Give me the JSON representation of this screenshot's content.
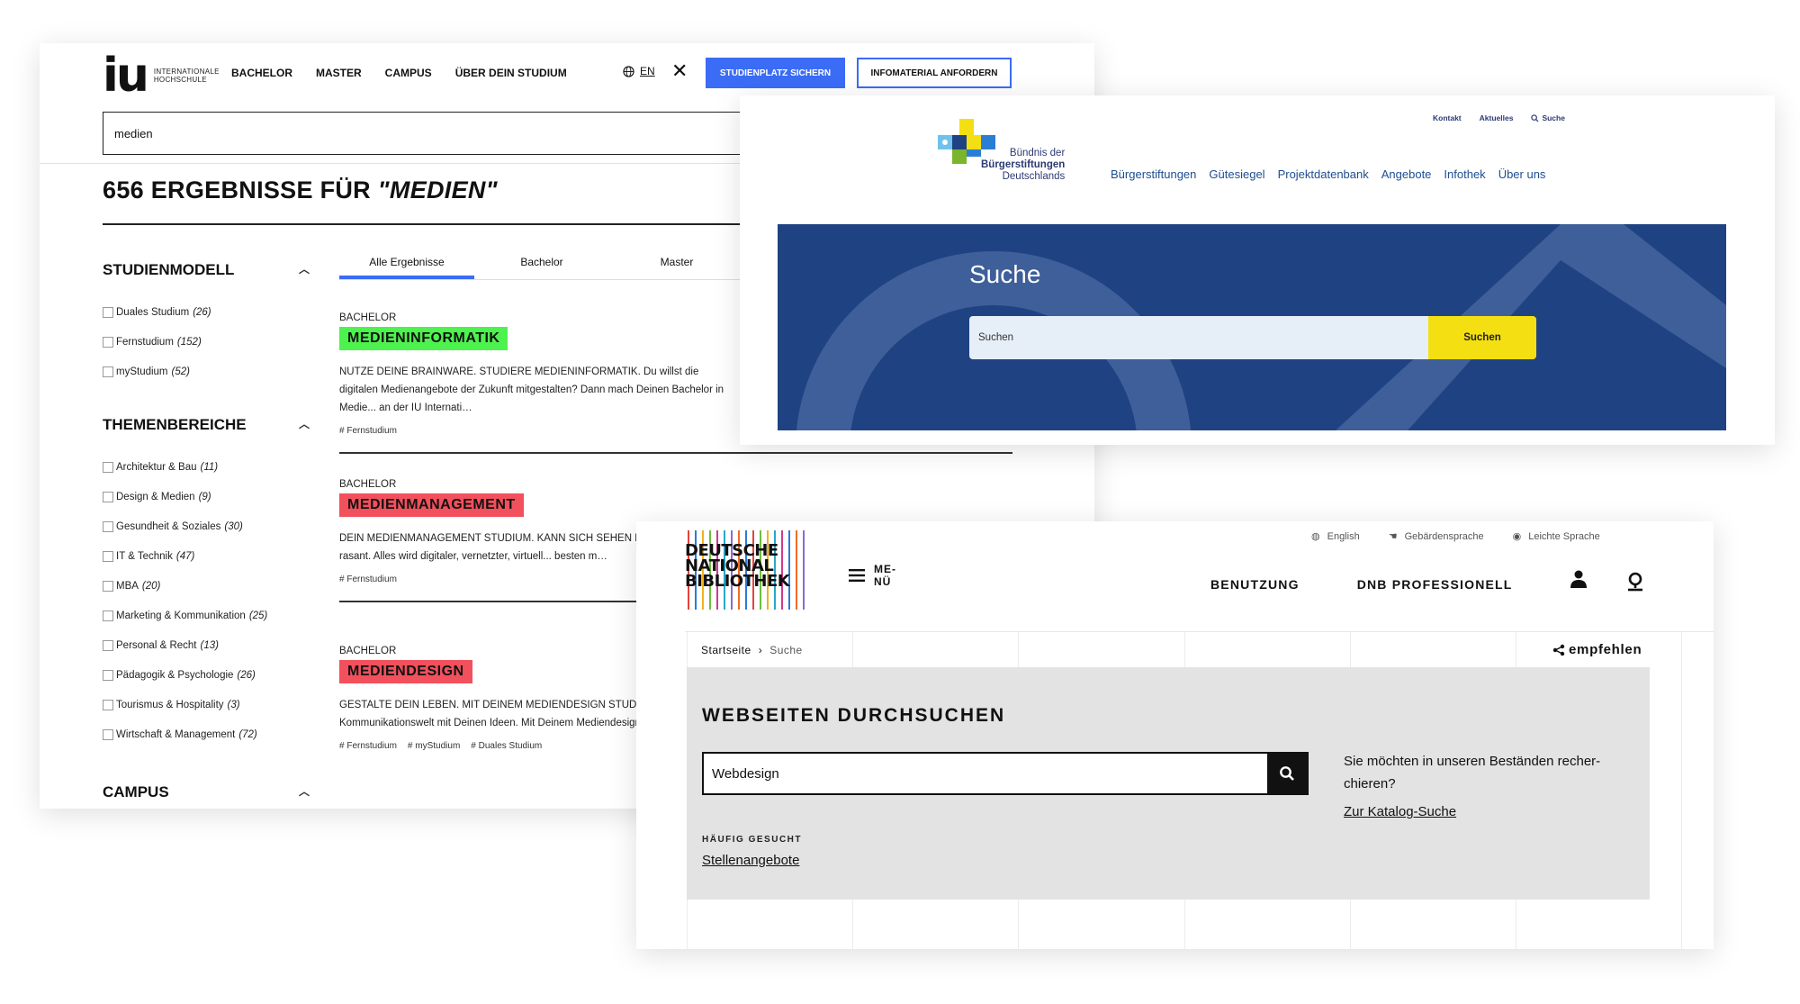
{
  "iu": {
    "logo_mark": "iu",
    "logo_sub": "INTERNATIONALE HOCHSCHULE",
    "nav": [
      "BACHELOR",
      "MASTER",
      "CAMPUS",
      "ÜBER DEIN STUDIUM"
    ],
    "lang": "EN",
    "cta_primary": "STUDIENPLATZ SICHERN",
    "cta_secondary": "INFOMATERIAL ANFORDERN",
    "search_value": "medien",
    "results_count": "656 ERGEBNISSE FÜR",
    "results_query": "\"MEDIEN\"",
    "filter_groups": [
      {
        "title": "STUDIENMODELL",
        "items": [
          {
            "label": "Duales Studium",
            "count": "(26)"
          },
          {
            "label": "Fernstudium",
            "count": "(152)"
          },
          {
            "label": "myStudium",
            "count": "(52)"
          }
        ]
      },
      {
        "title": "THEMENBEREICHE",
        "items": [
          {
            "label": "Architektur & Bau",
            "count": "(11)"
          },
          {
            "label": "Design & Medien",
            "count": "(9)"
          },
          {
            "label": "Gesundheit & Soziales",
            "count": "(30)"
          },
          {
            "label": "IT & Technik",
            "count": "(47)"
          },
          {
            "label": "MBA",
            "count": "(20)"
          },
          {
            "label": "Marketing & Kommunikation",
            "count": "(25)"
          },
          {
            "label": "Personal & Recht",
            "count": "(13)"
          },
          {
            "label": "Pädagogik & Psychologie",
            "count": "(26)"
          },
          {
            "label": "Tourismus & Hospitality",
            "count": "(3)"
          },
          {
            "label": "Wirtschaft & Management",
            "count": "(72)"
          }
        ]
      },
      {
        "title": "CAMPUS",
        "items": []
      }
    ],
    "tabs": [
      "Alle Ergebnisse",
      "Bachelor",
      "Master"
    ],
    "results": [
      {
        "category": "BACHELOR",
        "title": "MEDIENINFORMATIK",
        "color": "#4ef24e",
        "description": "NUTZE DEINE BRAINWARE. STUDIERE MEDIENINFORMATIK. Du willst die digitalen Medienangebote der Zukunft mitgestalten? Dann mach Deinen Bachelor in Medie... an der IU Internati…",
        "tags": [
          "# Fernstudium"
        ]
      },
      {
        "category": "BACHELOR",
        "title": "MEDIENMANAGEMENT",
        "color": "#f2505c",
        "description": "DEIN MEDIENMANAGEMENT STUDIUM. KANN SICH SEHEN LA... verändert sich rasant. Alles wird digitaler, vernetzter, virtuell... besten m…",
        "tags": [
          "# Fernstudium"
        ]
      },
      {
        "category": "BACHELOR",
        "title": "MEDIENDESIGN",
        "color": "#f2505c",
        "description": "GESTALTE DEIN LEBEN. MIT DEINEM MEDIENDESIGN STUDIU... analoge Kommunikationswelt mit Deinen Ideen. Mit Deinem Mediendesign sorgst Du f…",
        "tags": [
          "# Fernstudium",
          "# myStudium",
          "# Duales Studium"
        ]
      }
    ]
  },
  "bs": {
    "util": [
      "Kontakt",
      "Aktuelles",
      "Suche"
    ],
    "logo_line1": "Bündnis der",
    "logo_line2": "Bürgerstiftungen",
    "logo_line3": "Deutschlands",
    "menu": [
      "Bürgerstiftungen",
      "Gütesiegel",
      "Projektdatenbank",
      "Angebote",
      "Infothek",
      "Über uns"
    ],
    "hero_title": "Suche",
    "search_placeholder": "Suchen",
    "search_button": "Suchen"
  },
  "dnb": {
    "util": [
      "English",
      "Gebärdensprache",
      "Leichte Sprache"
    ],
    "logo_lines": [
      "DEUTSCHE",
      "NATIONAL",
      "BIBLIOTHEK"
    ],
    "menu_label_1": "ME-",
    "menu_label_2": "NÜ",
    "mainnav": [
      "BENUTZUNG",
      "DNB PROFESSIONELL"
    ],
    "breadcrumb_home": "Startseite",
    "breadcrumb_current": "Suche",
    "share": "empfehlen",
    "heading": "WEBSEITEN DURCHSUCHEN",
    "search_value": "Webdesign",
    "hint": "Sie möchten in unseren Beständen recher-chieren?",
    "katalog_link": "Zur Katalog-Suche",
    "frequent_label": "HÄUFIG GESUCHT",
    "frequent_link": "Stellenangebote"
  }
}
